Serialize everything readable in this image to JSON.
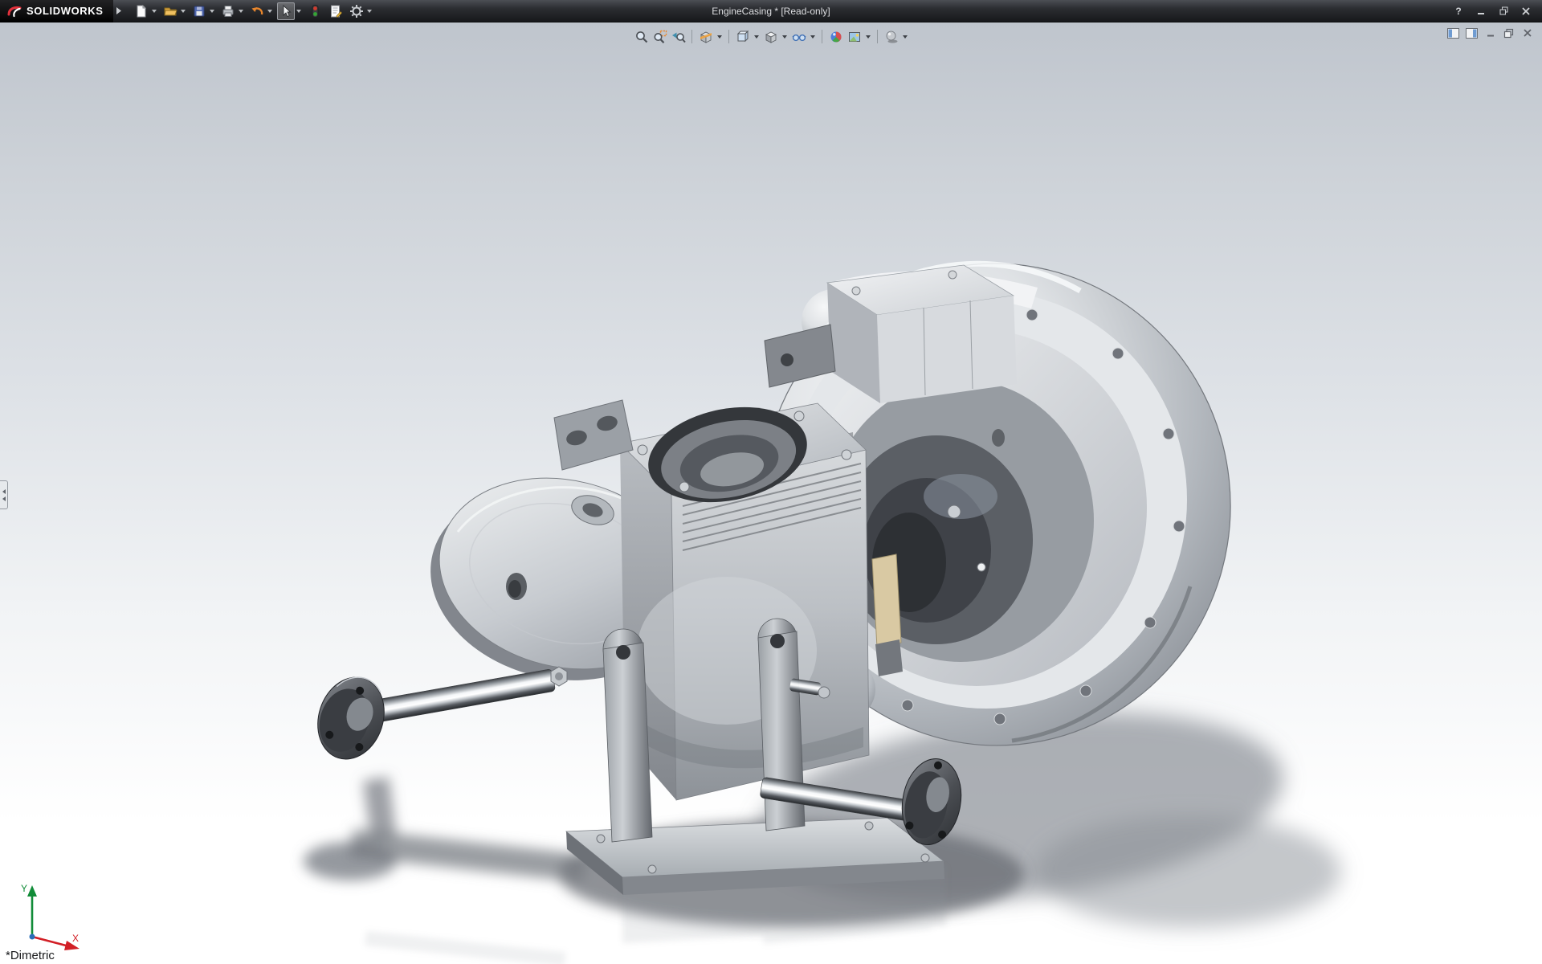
{
  "window": {
    "brand": "SOLIDWORKS",
    "title": "EngineCasing * [Read-only]",
    "help_glyph": "?",
    "controls": [
      "help",
      "minimize",
      "maximize",
      "close"
    ]
  },
  "menubar_toolbar": {
    "items": [
      {
        "name": "new-document",
        "icon": "new-document-icon",
        "dropdown": true
      },
      {
        "name": "open",
        "icon": "open-folder-icon",
        "dropdown": true
      },
      {
        "name": "save",
        "icon": "save-icon",
        "dropdown": true
      },
      {
        "name": "print",
        "icon": "print-icon",
        "dropdown": true
      },
      {
        "name": "undo",
        "icon": "undo-icon",
        "dropdown": true
      },
      {
        "name": "select",
        "icon": "select-arrow-icon",
        "dropdown": true,
        "active": true
      },
      {
        "name": "rebuild",
        "icon": "rebuild-stoplight-icon",
        "dropdown": false
      },
      {
        "name": "file-properties",
        "icon": "file-properties-icon",
        "dropdown": false
      },
      {
        "name": "options",
        "icon": "gear-icon",
        "dropdown": true
      }
    ]
  },
  "heads_up_toolbar": {
    "items": [
      {
        "name": "zoom-to-fit",
        "icon": "magnifier-icon",
        "dropdown": false
      },
      {
        "name": "zoom-to-area",
        "icon": "magnifier-area-icon",
        "dropdown": false
      },
      {
        "name": "previous-view",
        "icon": "magnifier-arrow-icon",
        "dropdown": false
      },
      {
        "name": "section-view",
        "icon": "section-cube-icon",
        "dropdown": true
      },
      {
        "name": "view-orientation",
        "icon": "view-cube-icon",
        "dropdown": true
      },
      {
        "name": "display-style",
        "icon": "shaded-cube-icon",
        "dropdown": true
      },
      {
        "name": "hide-show-items",
        "icon": "glasses-icon",
        "dropdown": true
      },
      {
        "name": "edit-appearance",
        "icon": "appearance-ball-icon",
        "dropdown": false
      },
      {
        "name": "apply-scene",
        "icon": "scene-photo-icon",
        "dropdown": true
      },
      {
        "name": "view-settings",
        "icon": "sphere-shadow-icon",
        "dropdown": true
      }
    ]
  },
  "document_controls": {
    "items": [
      "pane-toggle-left",
      "pane-toggle-right",
      "doc-minimize",
      "doc-restore",
      "doc-close"
    ]
  },
  "viewport": {
    "orientation_label": "*Dimetric",
    "triad": {
      "x_label": "X",
      "y_label": "Y"
    },
    "subject": "EngineCasing crankcase assembly on stand with handlebars",
    "background_top": "#bfc5cd",
    "background_bottom": "#ffffff"
  },
  "colors": {
    "titlebar": "#2b2d31",
    "logo_red": "#e4313c",
    "accent_orange": "#e8862c",
    "shadow": "#6b6f76",
    "metal_light": "#e8eaec",
    "metal_dark": "#55595f"
  }
}
